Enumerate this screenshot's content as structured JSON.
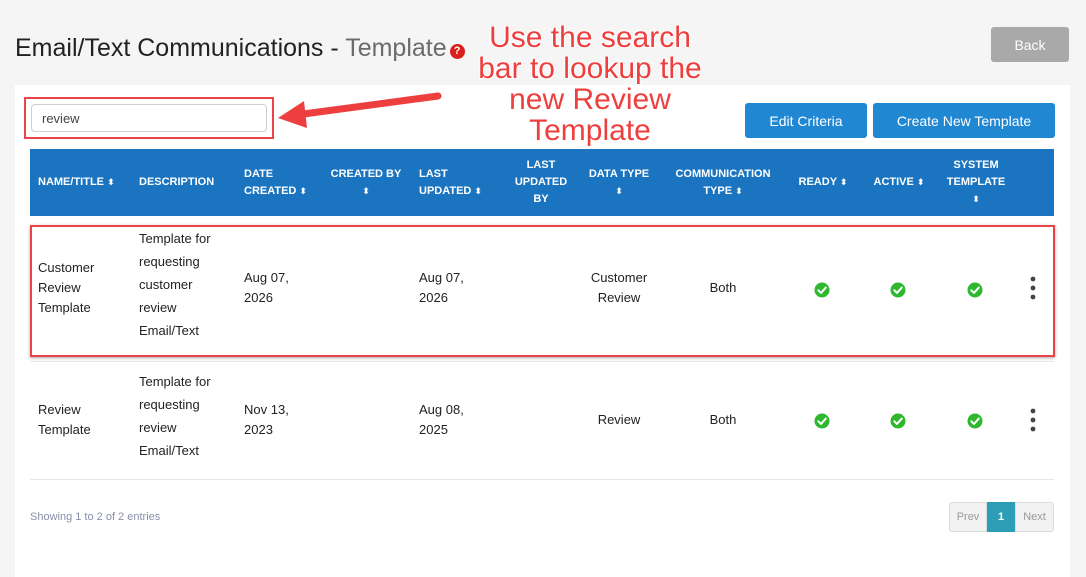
{
  "header": {
    "title": "Email/Text Communications - ",
    "subtitle": "Template",
    "help_icon": "?",
    "back_label": "Back"
  },
  "toolbar": {
    "search_value": "review",
    "edit_criteria_label": "Edit Criteria",
    "create_template_label": "Create New Template"
  },
  "table": {
    "columns": {
      "name": "NAME/TITLE",
      "description": "DESCRIPTION",
      "date_created_1": "DATE",
      "date_created_2": "CREATED",
      "created_by": "CREATED BY",
      "last_updated_1": "LAST",
      "last_updated_2": "UPDATED",
      "last_updated_by_1": "LAST",
      "last_updated_by_2": "UPDATED",
      "last_updated_by_3": "BY",
      "data_type": "DATA TYPE",
      "comm_type_1": "COMMUNICATION",
      "comm_type_2": "TYPE",
      "ready": "READY",
      "active": "ACTIVE",
      "system_template_1": "SYSTEM",
      "system_template_2": "TEMPLATE",
      "sort_icon": "⬍"
    },
    "rows": [
      {
        "name_lines": [
          "Customer",
          "Review",
          "Template"
        ],
        "desc_lines": [
          "Template for",
          "requesting",
          "customer",
          "review",
          "Email/Text"
        ],
        "created_lines": [
          "Aug 07,",
          "2026"
        ],
        "updated_lines": [
          "Aug 07,",
          "2026"
        ],
        "data_type_lines": [
          "Customer",
          "Review"
        ],
        "comm_type": "Both"
      },
      {
        "name_lines": [
          "Review",
          "Template"
        ],
        "desc_lines": [
          "Template for",
          "requesting",
          "review",
          "Email/Text"
        ],
        "created_lines": [
          "Nov 13,",
          "2023"
        ],
        "updated_lines": [
          "Aug 08,",
          "2025"
        ],
        "data_type_lines": [
          "Review"
        ],
        "comm_type": "Both"
      }
    ]
  },
  "footer": {
    "entries_info": "Showing 1 to 2 of 2 entries",
    "prev_label": "Prev",
    "page_label": "1",
    "next_label": "Next"
  },
  "annotation": {
    "lines": [
      "Use the search",
      "bar to lookup the",
      "new Review",
      "Template"
    ]
  },
  "colors": {
    "header_blue": "#1a74c0",
    "button_blue": "#2087d3",
    "annotation_red": "#ee3f3f",
    "check_green": "#2eb82e",
    "pager_active": "#2b9db4"
  }
}
